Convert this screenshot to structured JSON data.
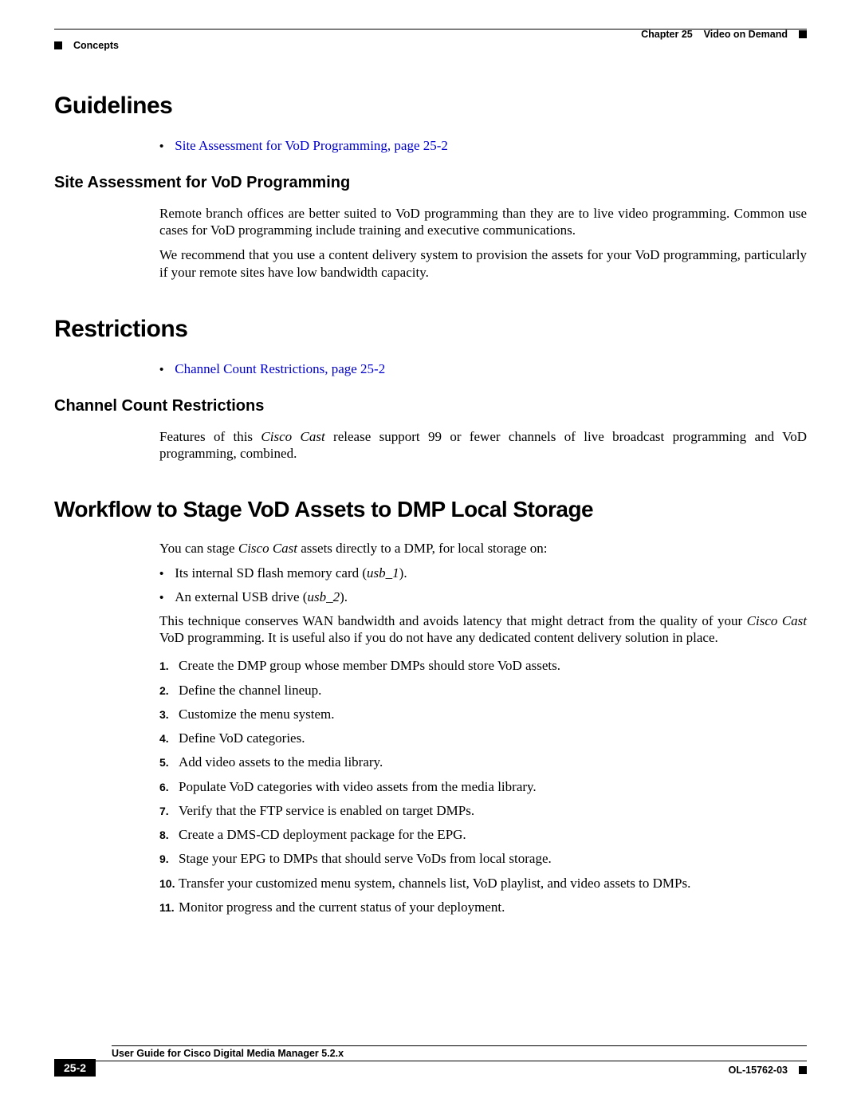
{
  "header": {
    "left": "Concepts",
    "right_chapter": "Chapter 25",
    "right_title": "Video on Demand"
  },
  "guidelines": {
    "heading": "Guidelines",
    "link": "Site Assessment for VoD Programming, page 25-2",
    "sub_heading": "Site Assessment for VoD Programming",
    "para1": "Remote branch offices are better suited to VoD programming than they are to live video programming. Common use cases for VoD programming include training and executive communications.",
    "para2": "We recommend that you use a content delivery system to provision the assets for your VoD programming, particularly if your remote sites have low bandwidth capacity."
  },
  "restrictions": {
    "heading": "Restrictions",
    "link": "Channel Count Restrictions, page 25-2",
    "sub_heading": "Channel Count Restrictions",
    "para_pre": "Features of this ",
    "para_em": "Cisco Cast",
    "para_post": " release support 99 or fewer channels of live broadcast programming and VoD programming, combined."
  },
  "workflow": {
    "heading": "Workflow to Stage VoD Assets to DMP Local Storage",
    "intro_pre": "You can stage ",
    "intro_em": "Cisco Cast",
    "intro_post": " assets directly to a DMP, for local storage on:",
    "bullet1_pre": "Its internal SD flash memory card (",
    "bullet1_em": "usb_1",
    "bullet1_post": ").",
    "bullet2_pre": "An external USB drive (",
    "bullet2_em": "usb_2",
    "bullet2_post": ").",
    "para2_pre": "This technique conserves WAN bandwidth and avoids latency that might detract from the quality of your ",
    "para2_em": "Cisco Cast",
    "para2_post": " VoD programming. It is useful also if you do not have any dedicated content delivery solution in place.",
    "steps": [
      "Create the DMP group whose member DMPs should store VoD assets.",
      "Define the channel lineup.",
      "Customize the menu system.",
      "Define VoD categories.",
      "Add video assets to the media library.",
      "Populate VoD categories with video assets from the media library.",
      "Verify that the FTP service is enabled on target DMPs.",
      "Create a DMS-CD deployment package for the EPG.",
      "Stage your EPG to DMPs that should serve VoDs from local storage.",
      "Transfer your customized menu system, channels list, VoD playlist, and video assets to DMPs.",
      "Monitor progress and the current status of your deployment."
    ]
  },
  "footer": {
    "guide_title": "User Guide for Cisco Digital Media Manager 5.2.x",
    "page_num": "25-2",
    "doc_ref": "OL-15762-03"
  }
}
